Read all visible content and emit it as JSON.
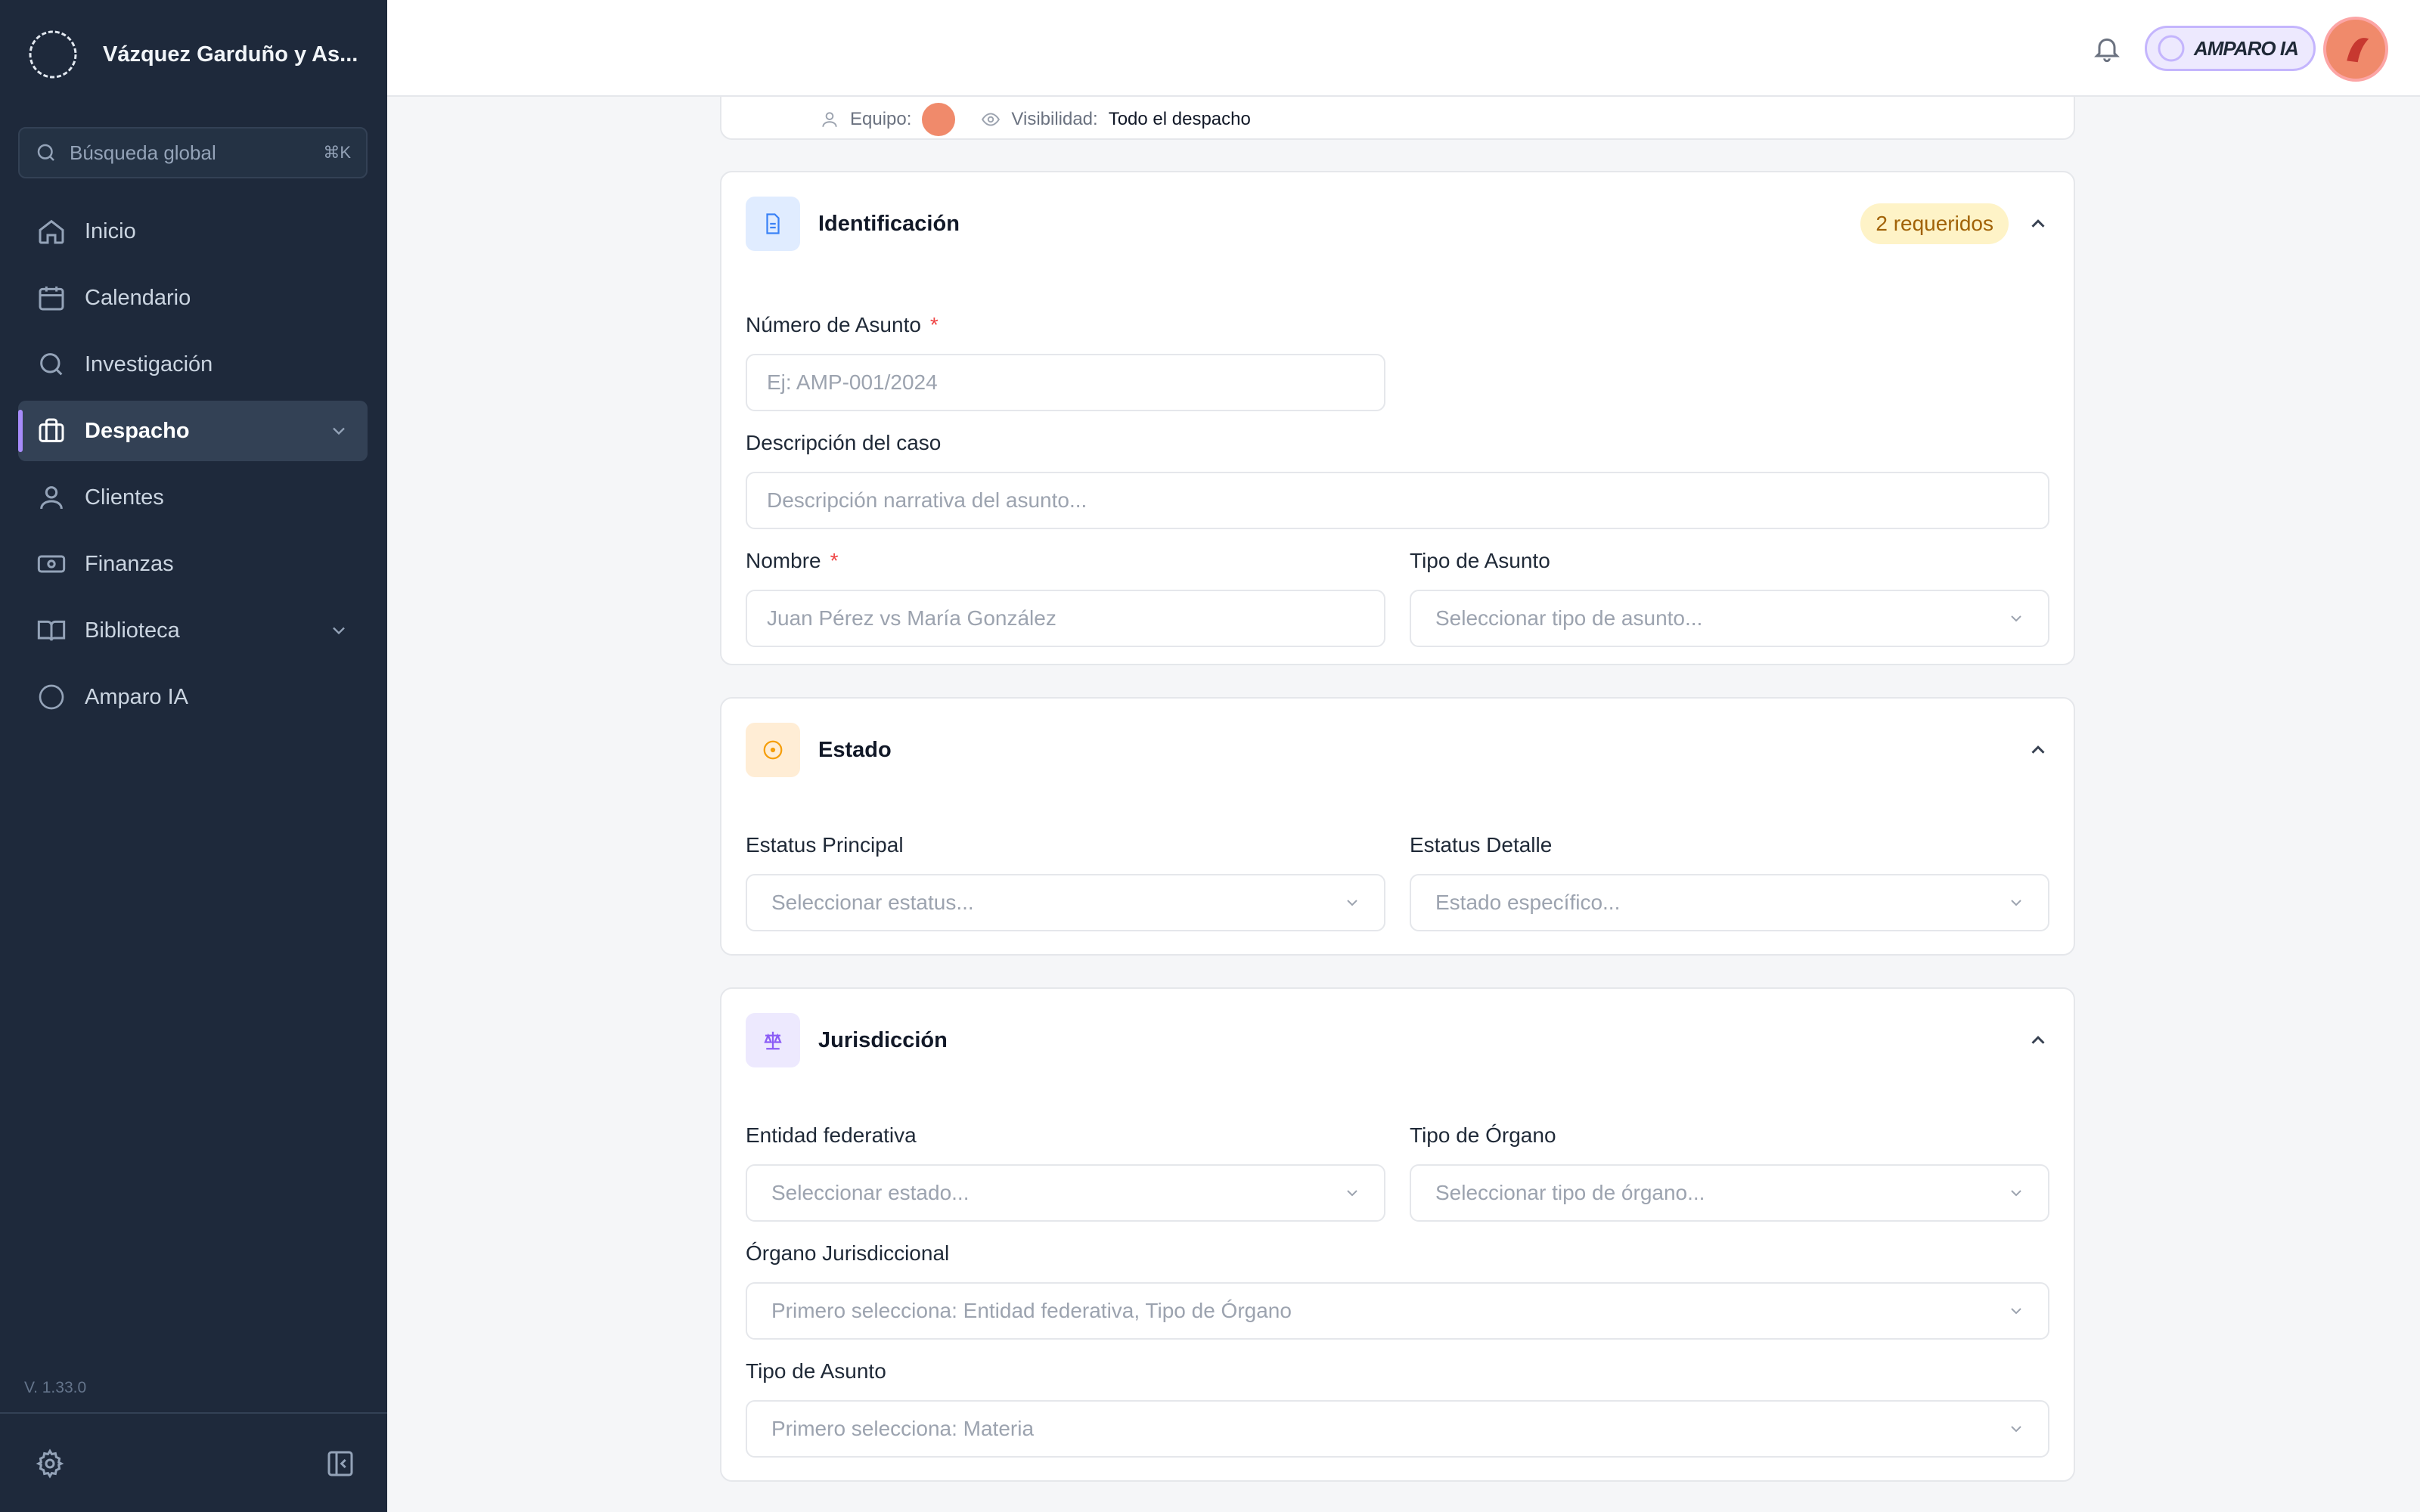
{
  "sidebar": {
    "brand": "Vázquez Garduño y As...",
    "search_placeholder": "Búsqueda global",
    "search_shortcut": "⌘K",
    "items": [
      {
        "label": "Inicio",
        "icon": "home-icon"
      },
      {
        "label": "Calendario",
        "icon": "calendar-icon"
      },
      {
        "label": "Investigación",
        "icon": "search-icon"
      },
      {
        "label": "Despacho",
        "icon": "briefcase-icon",
        "active": true
      },
      {
        "label": "Clientes",
        "icon": "user-icon"
      },
      {
        "label": "Finanzas",
        "icon": "money-icon"
      },
      {
        "label": "Biblioteca",
        "icon": "book-icon"
      },
      {
        "label": "Amparo IA",
        "icon": "amparo-logo-icon"
      }
    ],
    "version": "V. 1.33.0"
  },
  "topbar": {
    "assistant_label": "AMPARO IA"
  },
  "previous_card": {
    "team_label": "Equipo:",
    "visibility_label": "Visibilidad:",
    "visibility_value": "Todo el despacho"
  },
  "identificacion": {
    "title": "Identificación",
    "badge": "2 requeridos",
    "numero_label": "Número de Asunto",
    "numero_placeholder": "Ej: AMP-001/2024",
    "descripcion_label": "Descripción del caso",
    "descripcion_placeholder": "Descripción narrativa del asunto...",
    "nombre_label": "Nombre",
    "nombre_placeholder": "Juan Pérez vs María González",
    "tipo_label": "Tipo de Asunto",
    "tipo_placeholder": "Seleccionar tipo de asunto..."
  },
  "estado": {
    "title": "Estado",
    "principal_label": "Estatus Principal",
    "principal_placeholder": "Seleccionar estatus...",
    "detalle_label": "Estatus Detalle",
    "detalle_placeholder": "Estado específico..."
  },
  "jurisdiccion": {
    "title": "Jurisdicción",
    "entidad_label": "Entidad federativa",
    "entidad_placeholder": "Seleccionar estado...",
    "organo_tipo_label": "Tipo de Órgano",
    "organo_tipo_placeholder": "Seleccionar tipo de órgano...",
    "organo_label": "Órgano Jurisdiccional",
    "organo_placeholder": "Primero selecciona: Entidad federativa, Tipo de Órgano",
    "asunto_label": "Tipo de Asunto",
    "asunto_placeholder": "Primero selecciona: Materia"
  },
  "colors": {
    "sidebar_bg": "#1e293b",
    "accent": "#a78bfa",
    "badge_bg": "#fef3c7",
    "badge_text": "#a16207",
    "required": "#ef4444"
  }
}
